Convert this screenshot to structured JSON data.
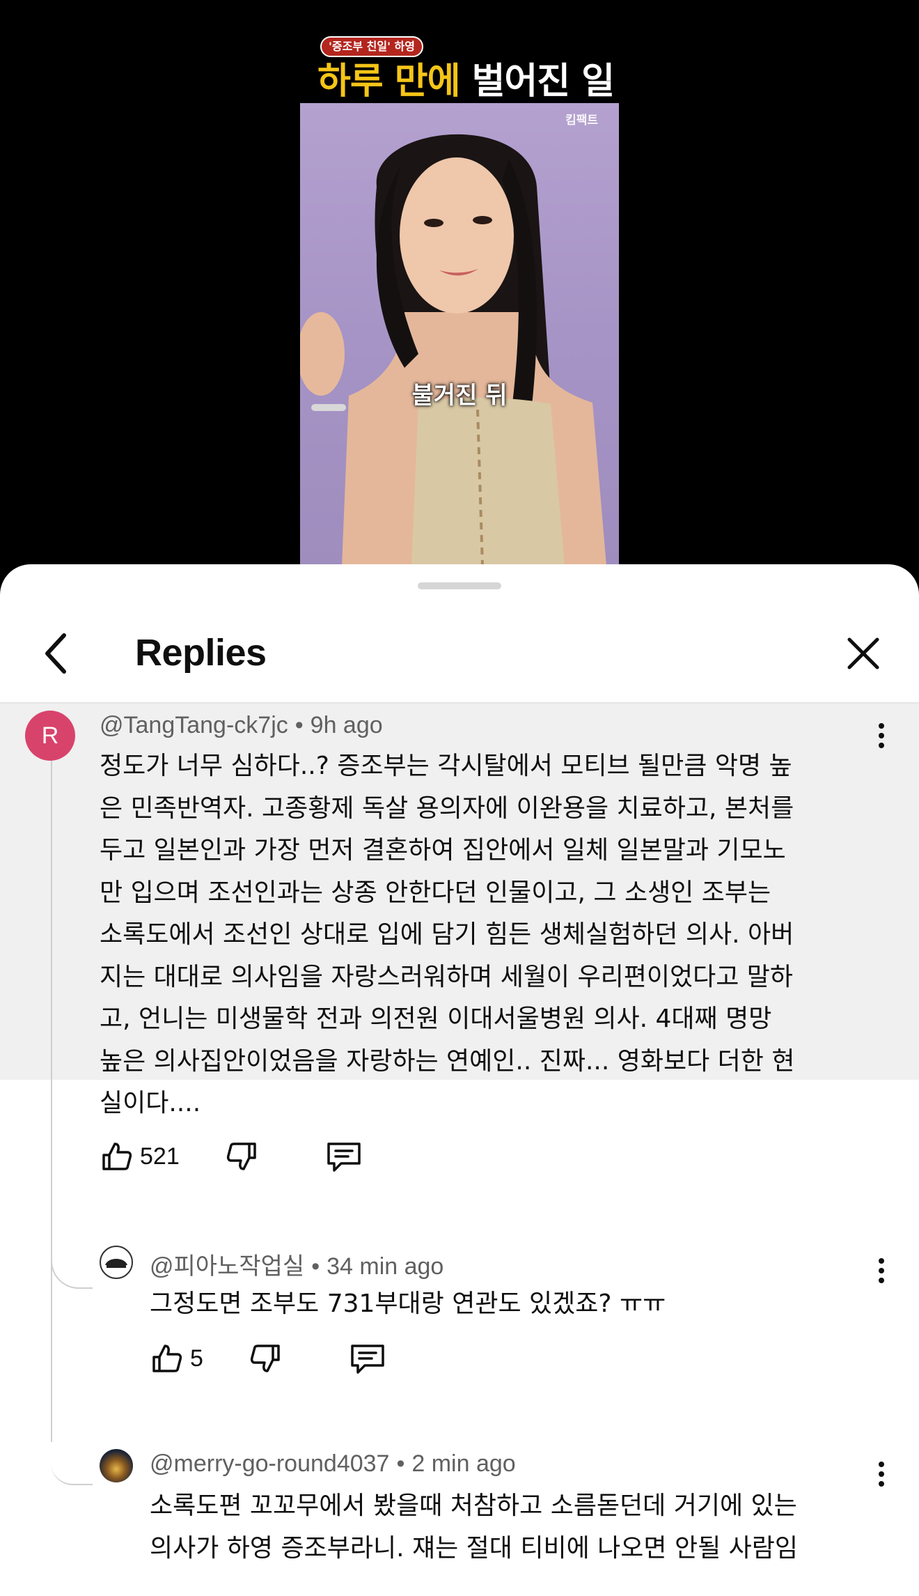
{
  "video": {
    "badge": "'증조부 친일' 하영",
    "headline_highlight": "하루 만에",
    "headline_rest": "벌어진 일",
    "watermark": "킴팩트",
    "caption": "불거진 뒤"
  },
  "sheet": {
    "title": "Replies"
  },
  "comments": [
    {
      "author": "@TangTang-ck7jc",
      "separator": "•",
      "time": "9h ago",
      "avatar_letter": "R",
      "avatar_color": "#d8436c",
      "text_lines": [
        "정도가 너무 심하다..? 증조부는 각시탈에서 모티브 될만큼 악명 높",
        "은 민족반역자. 고종황제 독살 용의자에 이완용을 치료하고, 본처를",
        "두고 일본인과 가장 먼저 결혼하여 집안에서 일체 일본말과 기모노",
        "만 입으며 조선인과는 상종 안한다던 인물이고, 그 소생인 조부는",
        "소록도에서 조선인 상대로 입에 담기 힘든 생체실험하던 의사. 아버",
        "지는 대대로 의사임을 자랑스러워하며 세월이 우리편이었다고 말하",
        "고, 언니는 미생물학 전과 의전원 이대서울병원 의사. 4대째 명망",
        "높은 의사집안이었음을 자랑하는 연예인.. 진짜... 영화보다 더한 현",
        "실이다...."
      ],
      "likes": "521"
    },
    {
      "author": "@피아노작업실",
      "separator": "•",
      "time": "34 min ago",
      "text_lines": [
        "그정도면 조부도 731부대랑 연관도 있겠죠? ㅠㅠ"
      ],
      "likes": "5"
    },
    {
      "author": "@merry-go-round4037",
      "separator": "•",
      "time": "2 min ago",
      "text_lines": [
        "소록도편 꼬꼬무에서 봤을때 처참하고 소름돋던데 거기에 있는",
        "의사가 하영 증조부라니. 쟤는 절대 티비에 나오면 안될 사람임"
      ]
    }
  ],
  "icons": {
    "back": "chevron-left-icon",
    "close": "close-icon",
    "like": "thumbs-up-icon",
    "dislike": "thumbs-down-icon",
    "reply": "comment-icon",
    "more": "more-vertical-icon"
  },
  "colors": {
    "parent_highlight_bg": "#f0f0f0",
    "badge_red": "#b3261e",
    "headline_yellow": "#f5c518"
  }
}
